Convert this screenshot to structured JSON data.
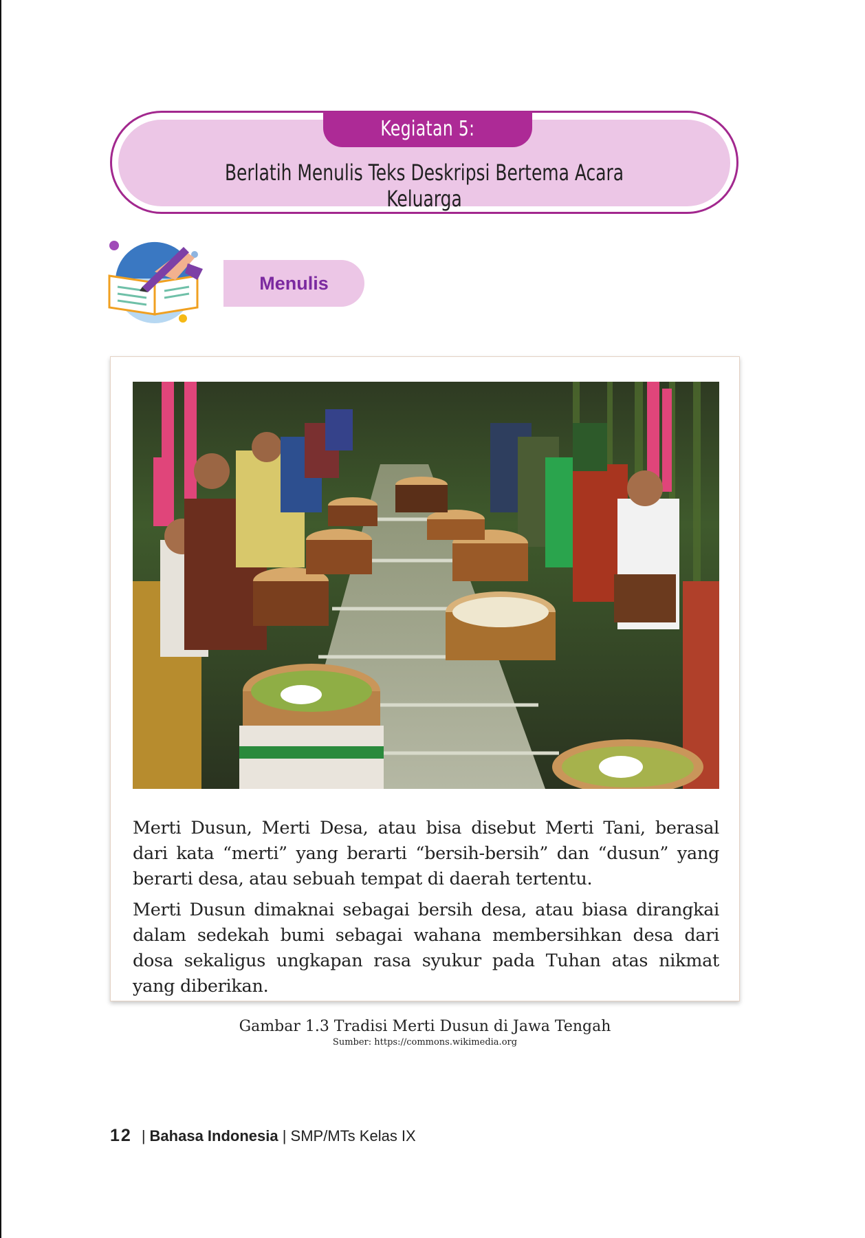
{
  "activity": {
    "tab_label": "Kegiatan 5:",
    "title": "Berlatih Menulis Teks Deskripsi Bertema Acara Keluarga"
  },
  "section": {
    "label": "Menulis",
    "icon": "writing-hand-book-icon"
  },
  "figure": {
    "image_description_icon": "merti-dusun-photo",
    "paragraphs": [
      "Merti Dusun, Merti Desa, atau bisa disebut Merti Tani, berasal dari kata “merti” yang berarti “bersih-bersih” dan “dusun” yang berarti desa, atau sebuah tempat di daerah tertentu.",
      "Merti Dusun dimaknai sebagai bersih desa, atau biasa dirangkai dalam sedekah bumi sebagai wahana membersihkan desa dari dosa sekaligus ungkapan rasa syukur pada Tuhan atas nikmat yang diberikan."
    ],
    "caption": "Gambar 1.3 Tradisi Merti Dusun di Jawa Tengah",
    "source": "Sumber: https://commons.wikimedia.org"
  },
  "footer": {
    "page_number": "12",
    "separator": "|",
    "subject": "Bahasa Indonesia",
    "class_info": "| SMP/MTs Kelas IX"
  },
  "colors": {
    "accent": "#ad2a96",
    "banner_fill": "#ecc6e6",
    "section_text": "#7b2aa0"
  }
}
